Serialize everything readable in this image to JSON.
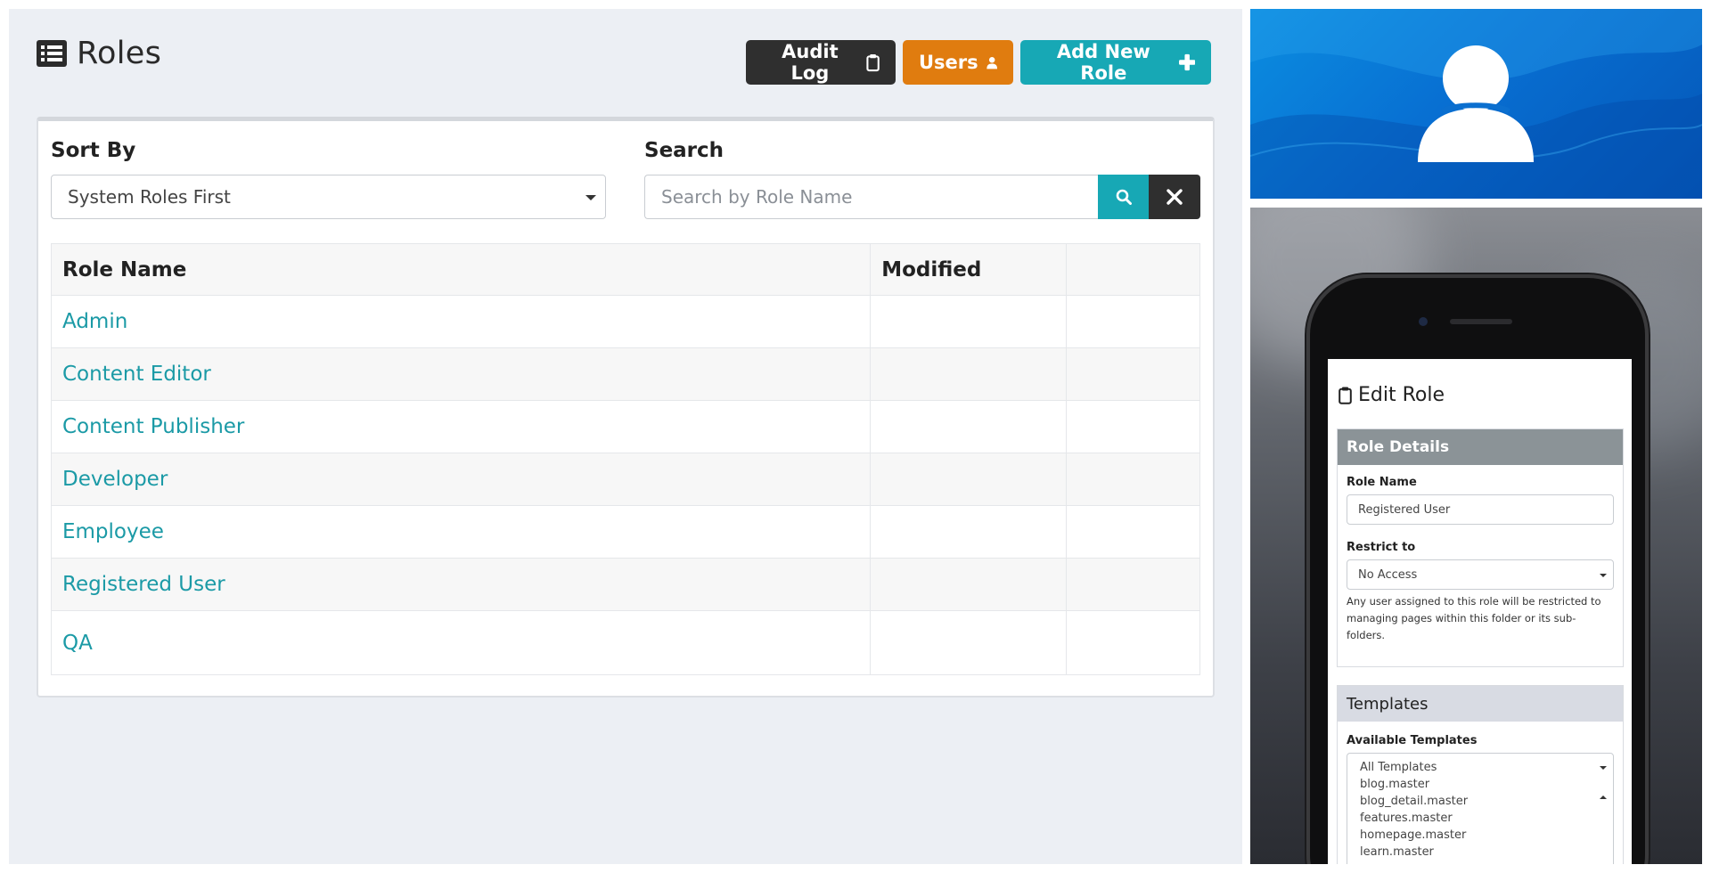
{
  "header": {
    "title": "Roles",
    "title_icon": "list-icon",
    "buttons": {
      "audit_log": "Audit Log",
      "users": "Users",
      "add_new_role": "Add New Role"
    }
  },
  "filters": {
    "sort_label": "Sort By",
    "sort_value": "System Roles First",
    "search_label": "Search",
    "search_placeholder": "Search by Role Name",
    "search_value": ""
  },
  "table": {
    "columns": [
      "Role Name",
      "Modified",
      ""
    ],
    "rows": [
      {
        "name": "Admin",
        "modified": ""
      },
      {
        "name": "Content Editor",
        "modified": ""
      },
      {
        "name": "Content Publisher",
        "modified": ""
      },
      {
        "name": "Developer",
        "modified": ""
      },
      {
        "name": "Employee",
        "modified": ""
      },
      {
        "name": "Registered User",
        "modified": ""
      },
      {
        "name": "QA",
        "modified": ""
      }
    ]
  },
  "phone": {
    "title": "Edit Role",
    "role_details": {
      "header": "Role Details",
      "role_name_label": "Role Name",
      "role_name_value": "Registered User",
      "restrict_label": "Restrict to",
      "restrict_value": "No Access",
      "help": "Any user assigned to this role will be restricted to managing pages within this folder or its sub-folders."
    },
    "templates": {
      "header": "Templates",
      "available_label": "Available Templates",
      "options": [
        "All Templates",
        "blog.master",
        "blog_detail.master",
        "features.master",
        "homepage.master",
        "learn.master"
      ]
    }
  },
  "colors": {
    "accent_teal": "#17a8b5",
    "button_dark": "#2f2f2f",
    "button_orange": "#e07c0f",
    "link": "#1b9aa6",
    "banner_blue": "#0a7bd6",
    "card_header_grey": "#8b9397"
  }
}
